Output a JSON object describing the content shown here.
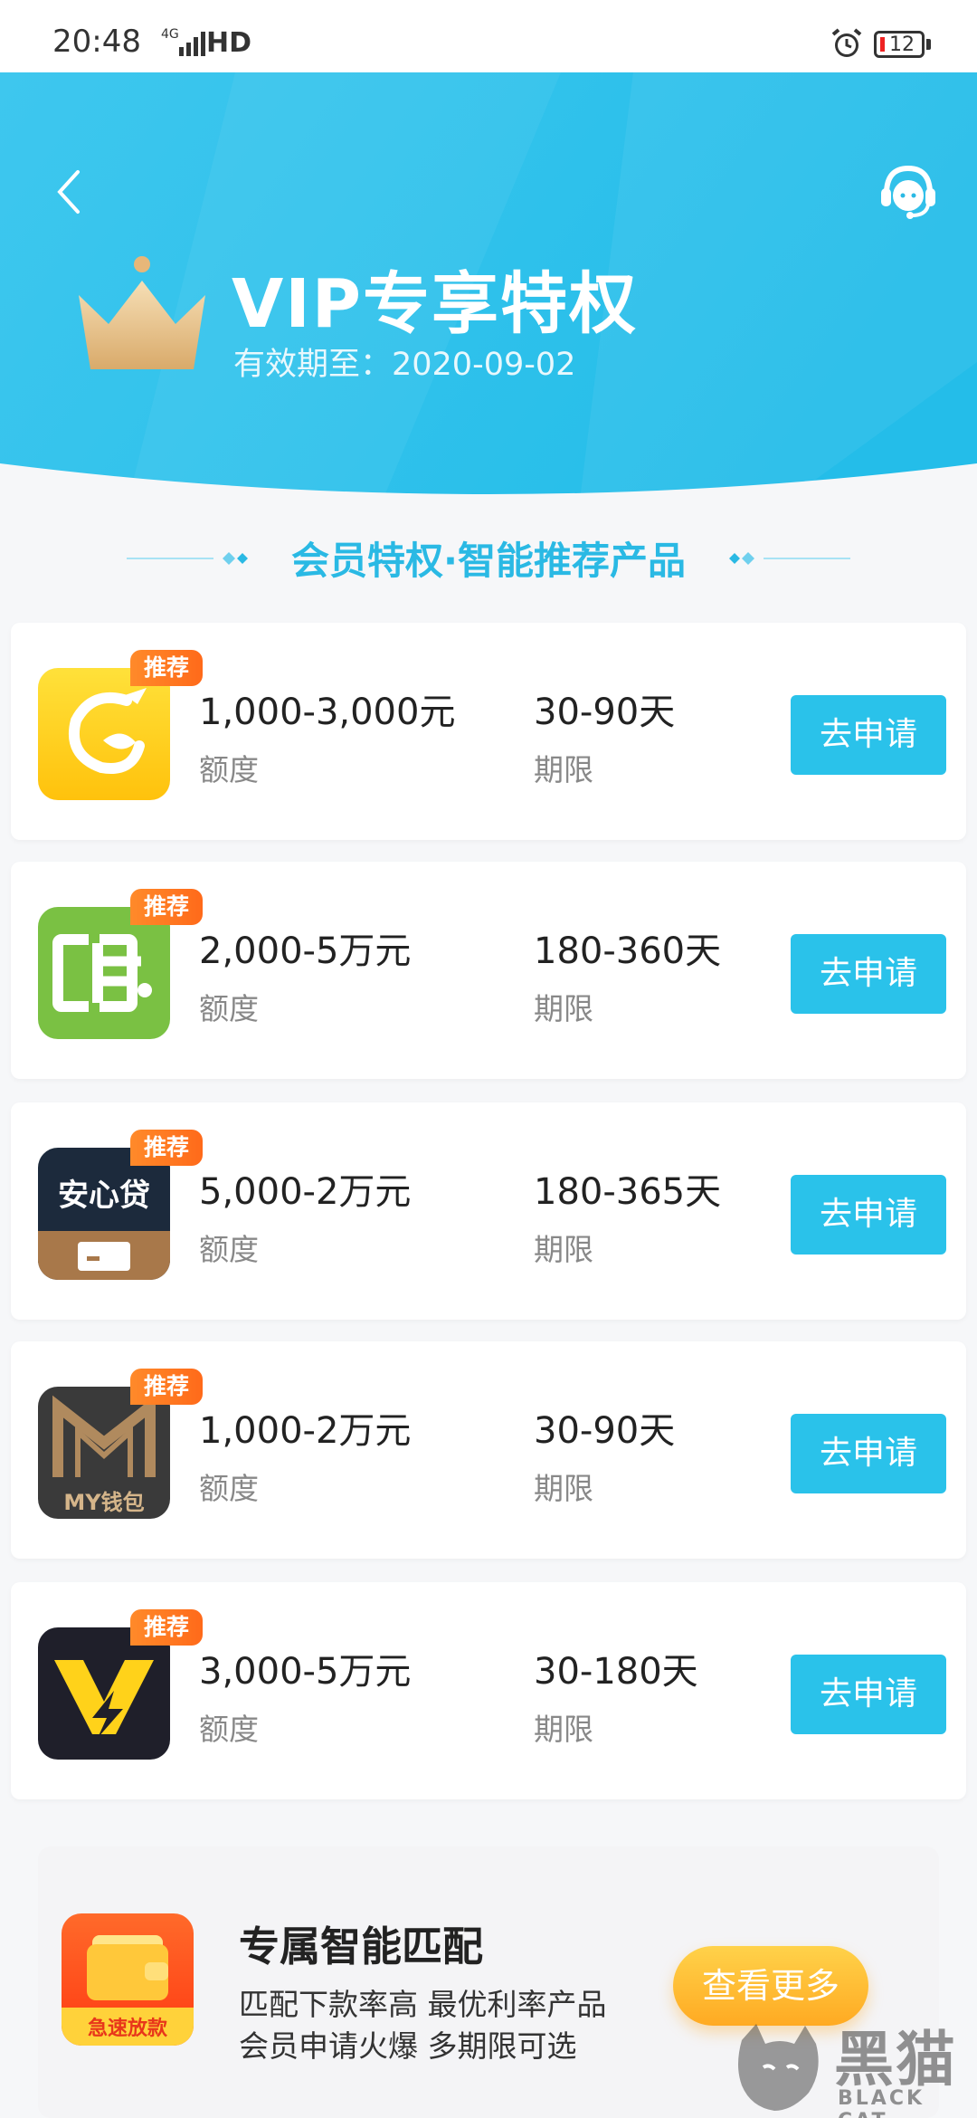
{
  "status_bar": {
    "time": "20:48",
    "network": "4G",
    "hd": "HD",
    "battery": "12"
  },
  "header": {
    "title": "VIP专享特权",
    "expiry": "有效期至：2020-09-02",
    "colors": {
      "bg_start": "#3ec7ee",
      "bg_end": "#22b8e6"
    }
  },
  "section": {
    "title": "会员特权·智能推荐产品"
  },
  "products": [
    {
      "badge": "推荐",
      "amount": "1,000-3,000元",
      "amount_label": "额度",
      "term": "30-90天",
      "term_label": "期限",
      "button": "去申请",
      "logo": "dragon-g-logo"
    },
    {
      "badge": "推荐",
      "amount": "2,000-5万元",
      "amount_label": "额度",
      "term": "180-360天",
      "term_label": "期限",
      "button": "去申请",
      "logo": "card-logo"
    },
    {
      "badge": "推荐",
      "amount": "5,000-2万元",
      "amount_label": "额度",
      "term": "180-365天",
      "term_label": "期限",
      "button": "去申请",
      "logo": "anxindai-logo",
      "logo_text": "安心贷"
    },
    {
      "badge": "推荐",
      "amount": "1,000-2万元",
      "amount_label": "额度",
      "term": "30-90天",
      "term_label": "期限",
      "button": "去申请",
      "logo": "my-wallet-logo",
      "logo_text": "MY钱包"
    },
    {
      "badge": "推荐",
      "amount": "3,000-5万元",
      "amount_label": "额度",
      "term": "30-180天",
      "term_label": "期限",
      "button": "去申请",
      "logo": "v-lightning-logo"
    }
  ],
  "match": {
    "title": "专属智能匹配",
    "line1": "匹配下款率高 最优利率产品",
    "line2": "会员申请火爆 多期限可选",
    "button": "查看更多",
    "logo_text": "急速放款"
  },
  "watermark": {
    "cn": "黑猫",
    "en": "BLACK CAT"
  }
}
